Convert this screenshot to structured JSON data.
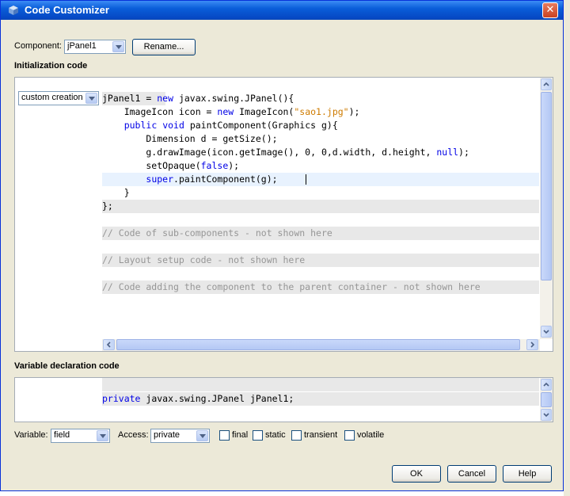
{
  "window": {
    "title": "Code Customizer",
    "close_glyph": "✕"
  },
  "component": {
    "label": "Component:",
    "value": "jPanel1",
    "rename_label": "Rename..."
  },
  "init_section": {
    "heading": "Initialization code",
    "mode_value": "custom creation",
    "lines": [
      "jPanel1 = new javax.swing.JPanel(){",
      "    ImageIcon icon = new ImageIcon(\"sao1.jpg\");",
      "    public void paintComponent(Graphics g){",
      "        Dimension d = getSize();",
      "        g.drawImage(icon.getImage(), 0, 0,d.width, d.height, null);",
      "        setOpaque(false);",
      "        super.paintComponent(g);",
      "    }",
      "};",
      "",
      "// Code of sub-components - not shown here",
      "",
      "// Layout setup code - not shown here",
      "",
      "// Code adding the component to the parent container - not shown here"
    ]
  },
  "var_section": {
    "heading": "Variable declaration code",
    "line": "private javax.swing.JPanel jPanel1;"
  },
  "options": {
    "variable_label": "Variable:",
    "variable_value": "field",
    "access_label": "Access:",
    "access_value": "private",
    "checkboxes": [
      "final",
      "static",
      "transient",
      "volatile"
    ]
  },
  "buttons": {
    "ok": "OK",
    "cancel": "Cancel",
    "help": "Help"
  }
}
